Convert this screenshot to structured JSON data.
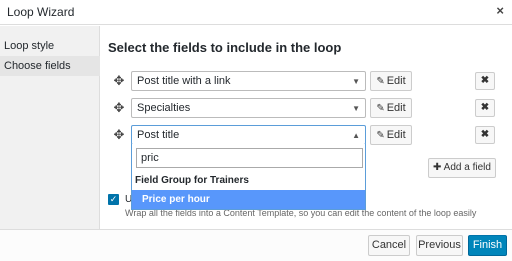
{
  "dialog": {
    "title": "Loop Wizard",
    "close_glyph": "×"
  },
  "sidebar": {
    "items": [
      {
        "label": "Loop style",
        "active": false
      },
      {
        "label": "Choose fields",
        "active": true
      }
    ]
  },
  "main": {
    "heading": "Select the fields to include in the loop",
    "fields": [
      {
        "value": "Post title with a link",
        "edit_label": "Edit"
      },
      {
        "value": "Specialties",
        "edit_label": "Edit"
      },
      {
        "value": "Post title",
        "edit_label": "Edit"
      }
    ],
    "add_field_label": "Add a field",
    "dropdown": {
      "search_value": "pric",
      "group_label": "Field Group for Trainers",
      "options": [
        "Price per hour"
      ],
      "highlighted_option": "Price per hour"
    },
    "template": {
      "checked": true,
      "label_visible": "U",
      "help_text": "Wrap all the fields into a Content Template, so you can edit the content of the loop easily"
    }
  },
  "footer": {
    "cancel_label": "Cancel",
    "previous_label": "Previous",
    "finish_label": "Finish"
  },
  "colors": {
    "primary": "#0085ba",
    "highlight": "#5897fb",
    "sidebar_bg": "#f1f1f1"
  },
  "icons": {
    "drag": "move-arrows-icon",
    "edit": "pencil-square-icon",
    "remove": "close-x-icon",
    "add": "plus-icon",
    "caret": "caret-down-icon"
  }
}
